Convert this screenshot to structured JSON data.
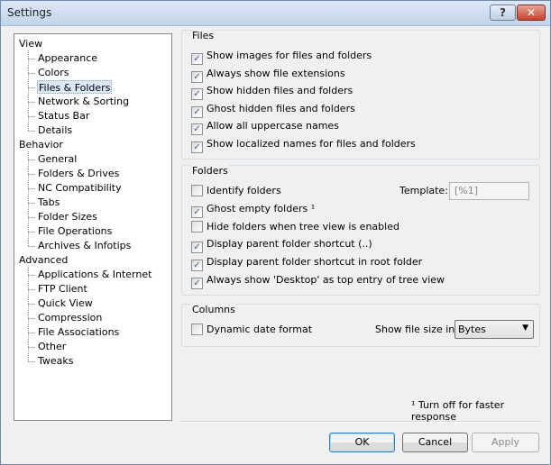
{
  "window": {
    "title": "Settings",
    "help": "?",
    "close": "✕"
  },
  "tree": [
    {
      "label": "View",
      "level": 0
    },
    {
      "label": "Appearance",
      "level": 1
    },
    {
      "label": "Colors",
      "level": 1
    },
    {
      "label": "Files & Folders",
      "level": 1,
      "selected": true
    },
    {
      "label": "Network & Sorting",
      "level": 1
    },
    {
      "label": "Status Bar",
      "level": 1
    },
    {
      "label": "Details",
      "level": 1
    },
    {
      "label": "Behavior",
      "level": 0
    },
    {
      "label": "General",
      "level": 1
    },
    {
      "label": "Folders & Drives",
      "level": 1
    },
    {
      "label": "NC Compatibility",
      "level": 1
    },
    {
      "label": "Tabs",
      "level": 1
    },
    {
      "label": "Folder Sizes",
      "level": 1
    },
    {
      "label": "File Operations",
      "level": 1
    },
    {
      "label": "Archives & Infotips",
      "level": 1
    },
    {
      "label": "Advanced",
      "level": 0
    },
    {
      "label": "Applications & Internet",
      "level": 1
    },
    {
      "label": "FTP Client",
      "level": 1
    },
    {
      "label": "Quick View",
      "level": 1
    },
    {
      "label": "Compression",
      "level": 1
    },
    {
      "label": "File Associations",
      "level": 1
    },
    {
      "label": "Other",
      "level": 1
    },
    {
      "label": "Tweaks",
      "level": 1
    }
  ],
  "files": {
    "label": "Files",
    "options": [
      {
        "label": "Show images for files and folders",
        "checked": true
      },
      {
        "label": "Always show file extensions",
        "checked": true
      },
      {
        "label": "Show hidden files and folders",
        "checked": true
      },
      {
        "label": "Ghost hidden files and folders",
        "checked": true
      },
      {
        "label": "Allow all uppercase names",
        "checked": true
      },
      {
        "label": "Show localized names for files and folders",
        "checked": true
      }
    ]
  },
  "folders": {
    "label": "Folders",
    "options": [
      {
        "label": "Identify folders",
        "checked": false
      },
      {
        "label": "Ghost empty folders ¹",
        "checked": true
      },
      {
        "label": "Hide folders when tree view is enabled",
        "checked": false
      },
      {
        "label": "Display parent folder shortcut (..)",
        "checked": true
      },
      {
        "label": "Display parent folder shortcut in root folder",
        "checked": true
      },
      {
        "label": "Always show 'Desktop' as top entry of tree view",
        "checked": true
      }
    ],
    "template_label": "Template:",
    "template_value": "[%1]"
  },
  "columns": {
    "label": "Columns",
    "dynamic_date": {
      "label": "Dynamic date format",
      "checked": false
    },
    "size_label": "Show file size in:",
    "size_value": "Bytes"
  },
  "footnote": "¹ Turn off for faster response",
  "buttons": {
    "ok": "OK",
    "cancel": "Cancel",
    "apply": "Apply"
  }
}
